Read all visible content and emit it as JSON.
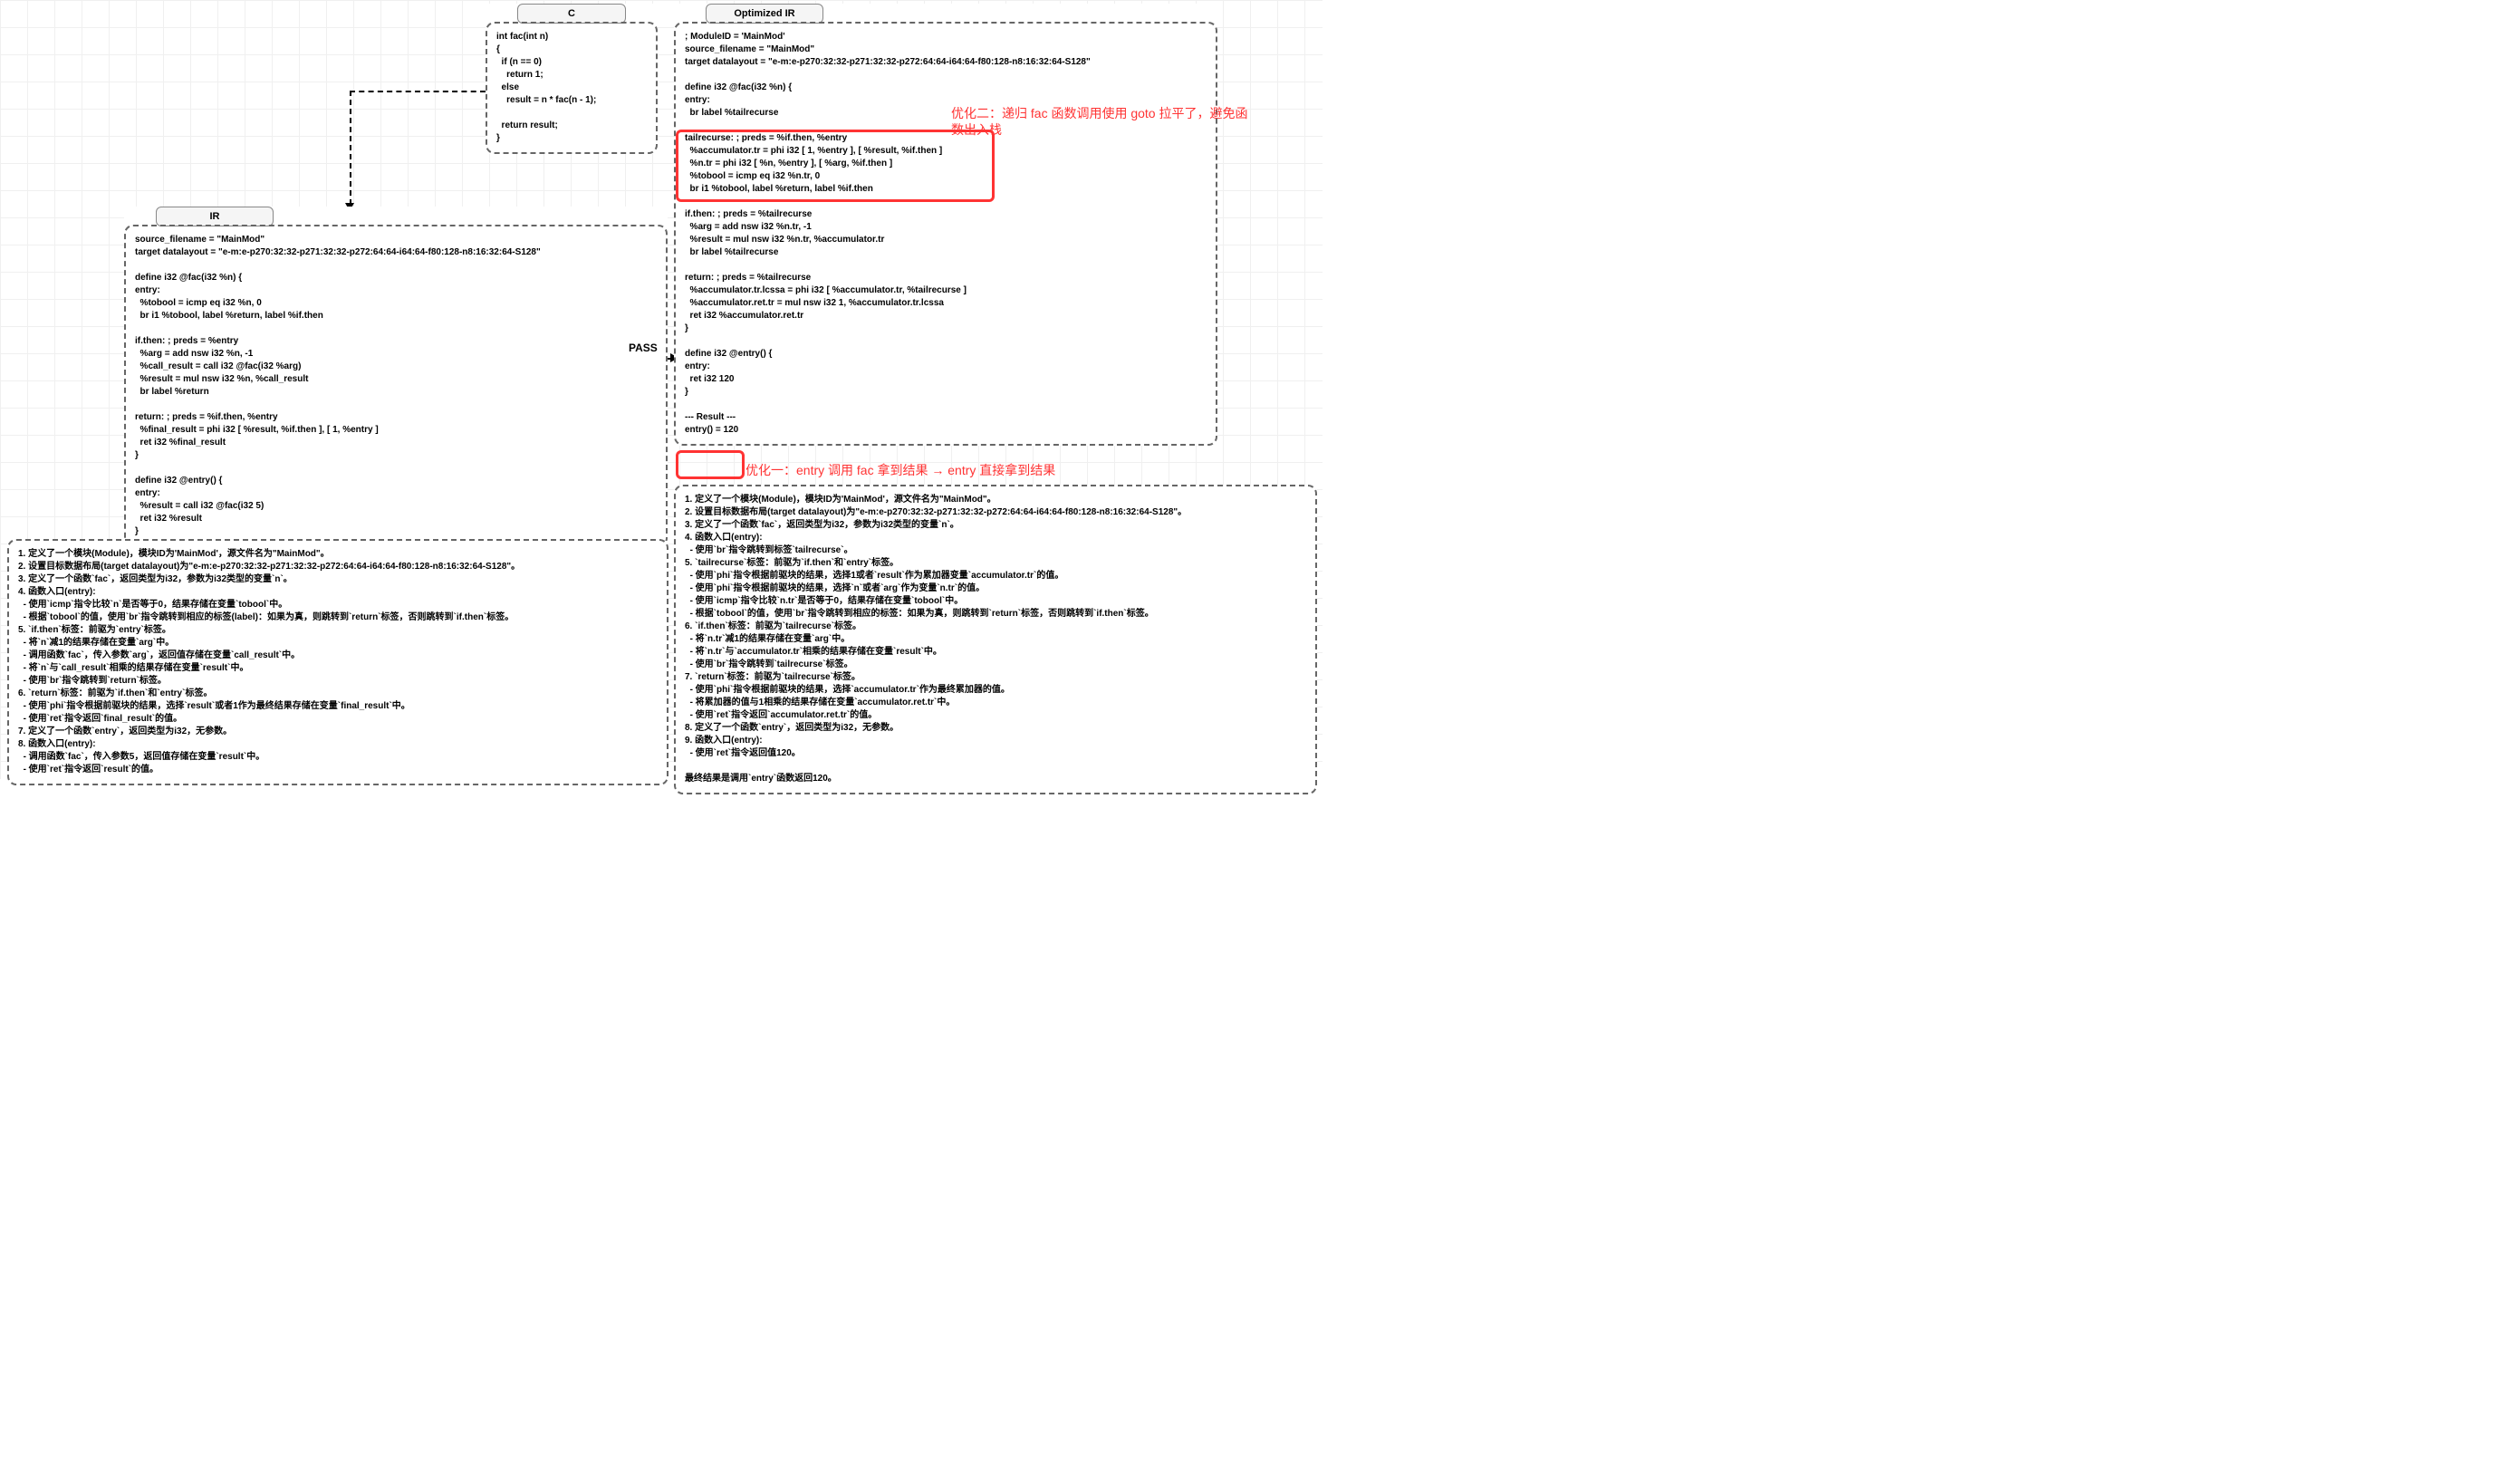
{
  "headers": {
    "c": "C",
    "ir": "IR",
    "optir": "Optimized IR"
  },
  "c_code": "int fac(int n)\n{\n  if (n == 0)\n    return 1;\n  else\n    result = n * fac(n - 1);\n\n  return result;\n}",
  "ir_code": "source_filename = \"MainMod\"\ntarget datalayout = \"e-m:e-p270:32:32-p271:32:32-p272:64:64-i64:64-f80:128-n8:16:32:64-S128\"\n\ndefine i32 @fac(i32 %n) {\nentry:\n  %tobool = icmp eq i32 %n, 0\n  br i1 %tobool, label %return, label %if.then\n\nif.then: ; preds = %entry\n  %arg = add nsw i32 %n, -1\n  %call_result = call i32 @fac(i32 %arg)\n  %result = mul nsw i32 %n, %call_result\n  br label %return\n\nreturn: ; preds = %if.then, %entry\n  %final_result = phi i32 [ %result, %if.then ], [ 1, %entry ]\n  ret i32 %final_result\n}\n\ndefine i32 @entry() {\nentry:\n  %result = call i32 @fac(i32 5)\n  ret i32 %result\n}",
  "ir_desc": "1. 定义了一个模块(Module)，模块ID为'MainMod'，源文件名为\"MainMod\"。\n2. 设置目标数据布局(target datalayout)为\"e-m:e-p270:32:32-p271:32:32-p272:64:64-i64:64-f80:128-n8:16:32:64-S128\"。\n3. 定义了一个函数`fac`，返回类型为i32，参数为i32类型的变量`n`。\n4. 函数入口(entry):\n  - 使用`icmp`指令比较`n`是否等于0，结果存储在变量`tobool`中。\n  - 根据`tobool`的值，使用`br`指令跳转到相应的标签(label)：如果为真，则跳转到`return`标签，否则跳转到`if.then`标签。\n5. `if.then`标签：前驱为`entry`标签。\n  - 将`n`减1的结果存储在变量`arg`中。\n  - 调用函数`fac`，传入参数`arg`，返回值存储在变量`call_result`中。\n  - 将`n`与`call_result`相乘的结果存储在变量`result`中。\n  - 使用`br`指令跳转到`return`标签。\n6. `return`标签：前驱为`if.then`和`entry`标签。\n  - 使用`phi`指令根据前驱块的结果，选择`result`或者1作为最终结果存储在变量`final_result`中。\n  - 使用`ret`指令返回`final_result`的值。\n7. 定义了一个函数`entry`，返回类型为i32，无参数。\n8. 函数入口(entry):\n  - 调用函数`fac`，传入参数5，返回值存储在变量`result`中。\n  - 使用`ret`指令返回`result`的值。",
  "optir_code": "; ModuleID = 'MainMod'\nsource_filename = \"MainMod\"\ntarget datalayout = \"e-m:e-p270:32:32-p271:32:32-p272:64:64-i64:64-f80:128-n8:16:32:64-S128\"\n\ndefine i32 @fac(i32 %n) {\nentry:\n  br label %tailrecurse\n\ntailrecurse: ; preds = %if.then, %entry\n  %accumulator.tr = phi i32 [ 1, %entry ], [ %result, %if.then ]\n  %n.tr = phi i32 [ %n, %entry ], [ %arg, %if.then ]\n  %tobool = icmp eq i32 %n.tr, 0\n  br i1 %tobool, label %return, label %if.then\n\nif.then: ; preds = %tailrecurse\n  %arg = add nsw i32 %n.tr, -1\n  %result = mul nsw i32 %n.tr, %accumulator.tr\n  br label %tailrecurse\n\nreturn: ; preds = %tailrecurse\n  %accumulator.tr.lcssa = phi i32 [ %accumulator.tr, %tailrecurse ]\n  %accumulator.ret.tr = mul nsw i32 1, %accumulator.tr.lcssa\n  ret i32 %accumulator.ret.tr\n}\n\ndefine i32 @entry() {\nentry:\n  ret i32 120\n}\n\n--- Result ---\nentry() = 120",
  "optir_desc": "1. 定义了一个模块(Module)，模块ID为'MainMod'，源文件名为\"MainMod\"。\n2. 设置目标数据布局(target datalayout)为\"e-m:e-p270:32:32-p271:32:32-p272:64:64-i64:64-f80:128-n8:16:32:64-S128\"。\n3. 定义了一个函数`fac`，返回类型为i32，参数为i32类型的变量`n`。\n4. 函数入口(entry):\n  - 使用`br`指令跳转到标签`tailrecurse`。\n5. `tailrecurse`标签：前驱为`if.then`和`entry`标签。\n  - 使用`phi`指令根据前驱块的结果，选择1或者`result`作为累加器变量`accumulator.tr`的值。\n  - 使用`phi`指令根据前驱块的结果，选择`n`或者`arg`作为变量`n.tr`的值。\n  - 使用`icmp`指令比较`n.tr`是否等于0，结果存储在变量`tobool`中。\n  - 根据`tobool`的值，使用`br`指令跳转到相应的标签：如果为真，则跳转到`return`标签，否则跳转到`if.then`标签。\n6. `if.then`标签：前驱为`tailrecurse`标签。\n  - 将`n.tr`减1的结果存储在变量`arg`中。\n  - 将`n.tr`与`accumulator.tr`相乘的结果存储在变量`result`中。\n  - 使用`br`指令跳转到`tailrecurse`标签。\n7. `return`标签：前驱为`tailrecurse`标签。\n  - 使用`phi`指令根据前驱块的结果，选择`accumulator.tr`作为最终累加器的值。\n  - 将累加器的值与1相乘的结果存储在变量`accumulator.ret.tr`中。\n  - 使用`ret`指令返回`accumulator.ret.tr`的值。\n8. 定义了一个函数`entry`，返回类型为i32，无参数。\n9. 函数入口(entry):\n  - 使用`ret`指令返回值120。\n\n最终结果是调用`entry`函数返回120。",
  "pass_label": "PASS",
  "anno1": "优化一：entry 调用 fac 拿到结果 → entry 直接拿到结果",
  "anno2": "优化二：递归 fac 函数调用使用 goto\n拉平了，避免函数出入栈"
}
